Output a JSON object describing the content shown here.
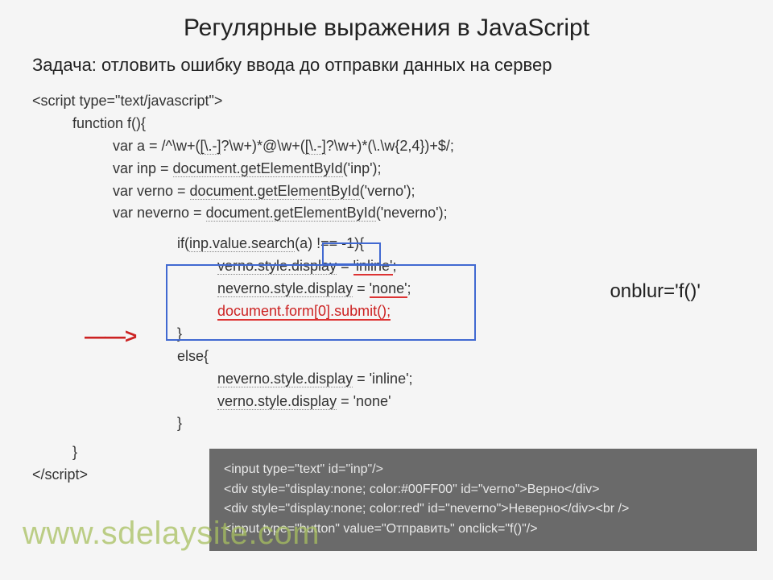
{
  "title": "Регулярные выражения в JavaScript",
  "subtitle": "Задача: отловить ошибку ввода до отправки данных на сервер",
  "code": {
    "l1": "<script type=\"text/javascript\">",
    "l2": "function f(){",
    "l3_a": "var a = /^\\w+(",
    "l3_b": "[\\.-]",
    "l3_c": "?\\w+)*@\\w+(",
    "l3_d": "[\\.-]",
    "l3_e": "?\\w+)*(\\.\\w{2,4})+$/;",
    "l4_a": "var inp = ",
    "l4_b": "document.getElementById",
    "l4_c": "('inp');",
    "l5_a": "var verno = ",
    "l5_b": "document.getElementById",
    "l5_c": "('verno');",
    "l6_a": "var neverno = ",
    "l6_b": "document.getElementById",
    "l6_c": "('neverno');",
    "l7_a": "if(",
    "l7_b": "inp.value.search",
    "l7_c": "(a) ",
    "l7_d": "!== -1",
    "l7_e": "){",
    "l8_a": "verno.style.display",
    "l8_b": " = ",
    "l8_c": "'inline'",
    "l8_d": ";",
    "l9_a": "neverno.style.display",
    "l9_b": " = ",
    "l9_c": "'none'",
    "l9_d": ";",
    "l10": "document.form[0].submit();",
    "l11": "}",
    "l12": "else{",
    "l13_a": "neverno.style.display",
    "l13_b": " = 'inline';",
    "l14_a": "verno.style.display",
    "l14_b": " = 'none'",
    "l15": "}",
    "l16": "}",
    "l17": "</script>"
  },
  "onblur": "onblur='f()'",
  "footer": {
    "f1": "<input type=\"text\"  id=\"inp\"/>",
    "f2": "<div style=\"display:none; color:#00FF00\" id=\"verno\">Верно</div>",
    "f3": "<div style=\"display:none; color:red\" id=\"neverno\">Неверно</div><br />",
    "f4": "<input type=\"button\" value=\"Отправить\" onclick=\"f()\"/>"
  },
  "watermark": "www.sdelaysite.com",
  "arrow": "——>"
}
